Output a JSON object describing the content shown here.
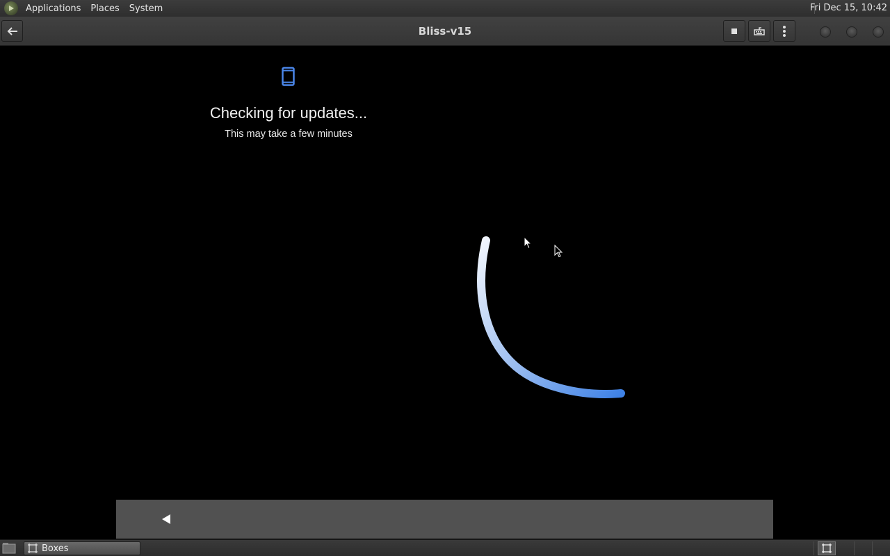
{
  "top_panel": {
    "menus": [
      "Applications",
      "Places",
      "System"
    ],
    "clock": "Fri Dec 15, 10:42"
  },
  "headerbar": {
    "title": "Bliss-v15",
    "icons": [
      "back-arrow-icon",
      "stop-icon",
      "keyboard-icon",
      "kebab-menu-icon"
    ]
  },
  "vm_screen": {
    "heading": "Checking for updates...",
    "subheading": "This may take a few minutes",
    "icon": "phone-icon",
    "accent": "#4a86e8"
  },
  "taskbar": {
    "task_label": "Boxes"
  }
}
